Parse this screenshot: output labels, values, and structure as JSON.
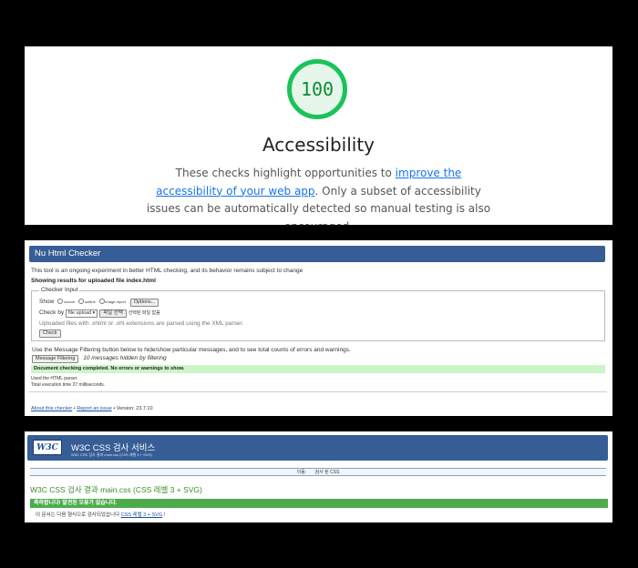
{
  "lighthouse": {
    "score": "100",
    "title": "Accessibility",
    "desc_before": "These checks highlight opportunities to ",
    "desc_link": "improve the accessibility of your web app",
    "desc_after": ". Only a subset of accessibility issues can be automatically detected so manual testing is also encouraged.",
    "score_color": "#19c35a"
  },
  "nu": {
    "header": "Nu Html Checker",
    "intro": "This tool is an ongoing experiment in better HTML checking, and its behavior remains subject to change",
    "showing": "Showing results for uploaded file index.html",
    "legend": "Checker Input",
    "show_label": "Show",
    "show_options": [
      "source",
      "outline",
      "image report"
    ],
    "options_button": "Options...",
    "check_by_label": "Check by",
    "check_by_value": "file upload",
    "file_button": "파일 선택",
    "file_status": "선택된 파일 없음",
    "upload_note": "Uploaded files with .xhtml or .xht extensions are parsed using the XML parser.",
    "check_button": "Check",
    "filter_note": "Use the Message Filtering button below to hide/show particular messages, and to see total counts of errors and warnings.",
    "filter_button": "Message Filtering",
    "hidden_note": "10 messages hidden by filtering",
    "success": "Document checking completed. No errors or warnings to show.",
    "parser_note": "Used the HTML parser.",
    "time_note": "Total execution time 27 milliseconds.",
    "footer_about": "About this checker",
    "footer_report": "Report an issue",
    "footer_version": "Version: 23.7.10",
    "header_color": "#365d95"
  },
  "w3c": {
    "logo": "W3C",
    "title": "W3C CSS 검사 서비스",
    "subtitle": "W3C CSS 검사 결과 main.css (CSS 레벨 3 + SVG)",
    "nav_label": "이동:",
    "nav_link": "검사 된 CSS",
    "result_title": "W3C CSS 검사 결과 main.css (CSS 레벨 3 + SVG)",
    "success": "축하합니다! 발견된 오류가 없습니다.",
    "detail_before": "이 문서는 다음 형식으로 검사되었습니다 ",
    "detail_link": "CSS 레벨 3 + SVG",
    "detail_after": " !",
    "success_color": "#4cac4c"
  }
}
